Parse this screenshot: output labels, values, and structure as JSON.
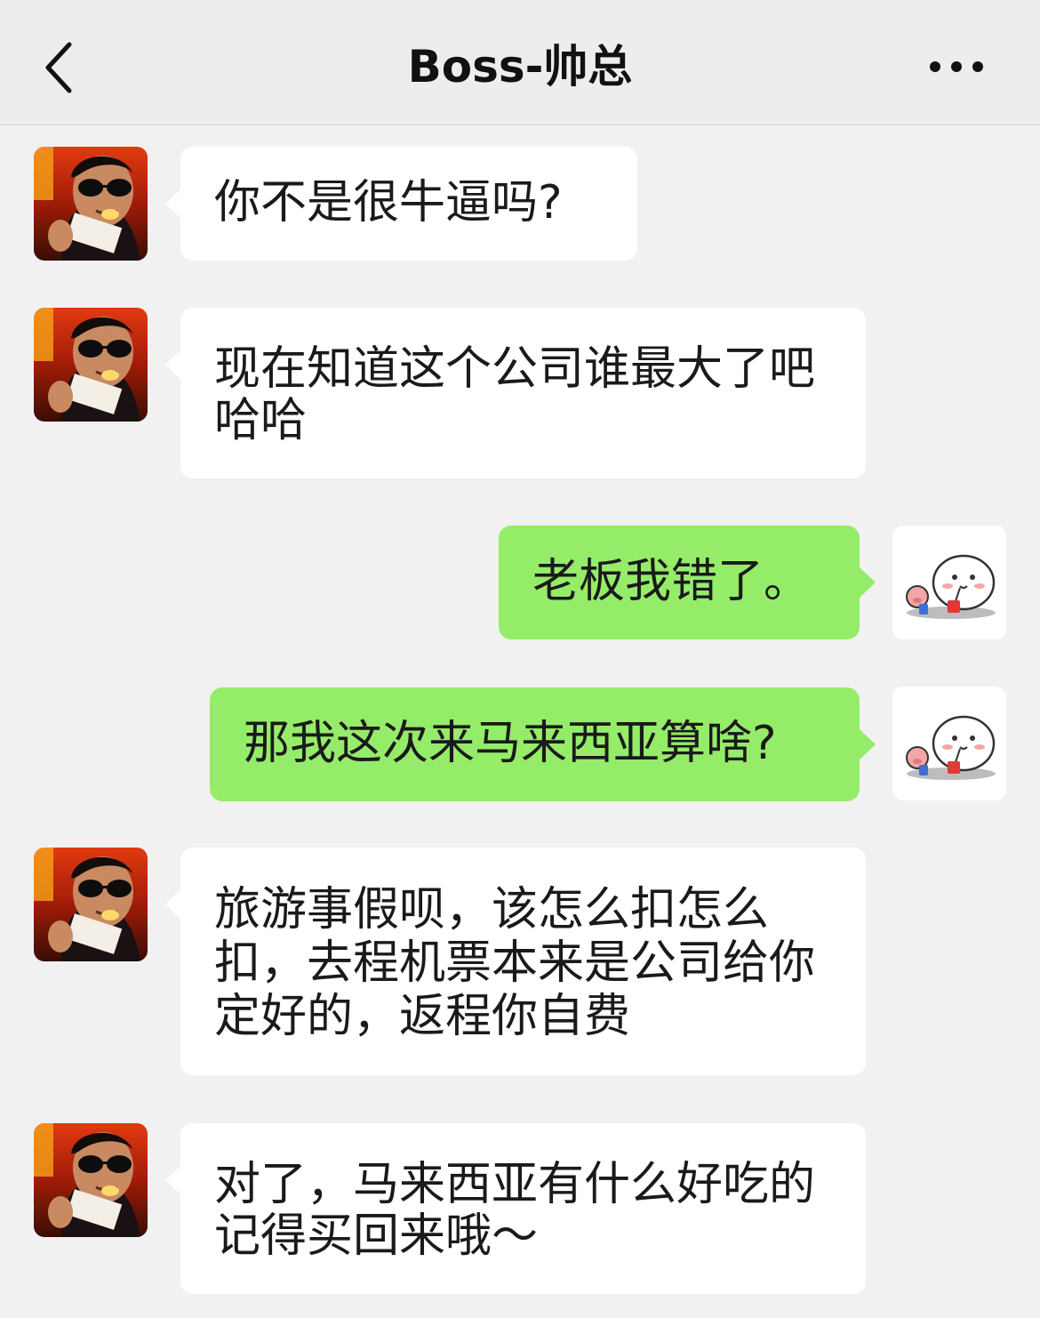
{
  "header": {
    "title": "Boss-帅总",
    "back_icon": "chevron-left-icon",
    "more_icon": "more-dots-icon"
  },
  "colors": {
    "background": "#f1f1f1",
    "header_bg": "#ededed",
    "incoming_bubble": "#ffffff",
    "outgoing_bubble": "#95ec69"
  },
  "messages": [
    {
      "sender": "boss",
      "text": "你不是很牛逼吗?"
    },
    {
      "sender": "boss",
      "text": "现在知道这个公司谁最大了吧\n哈哈"
    },
    {
      "sender": "me",
      "text": "老板我错了。"
    },
    {
      "sender": "me",
      "text": "那我这次来马来西亚算啥?"
    },
    {
      "sender": "boss",
      "text": "旅游事假呗，该怎么扣怎么\n扣，去程机票本来是公司给你\n定好的，返程你自费"
    },
    {
      "sender": "boss",
      "text": "对了，马来西亚有什么好吃的\n记得买回来哦～"
    }
  ]
}
